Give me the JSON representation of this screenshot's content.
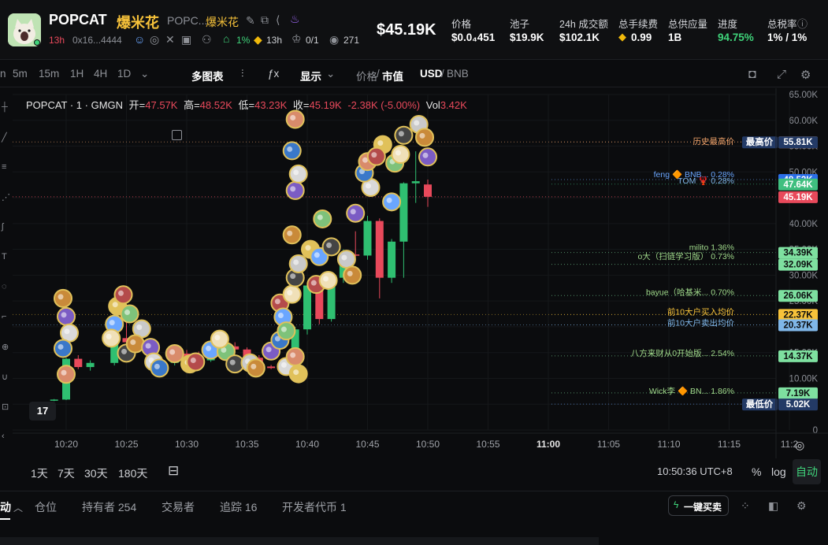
{
  "token": {
    "ticker": "POPCAT",
    "name_cn": "爆米花",
    "short_name": "POPC...",
    "short_name_cn": "爆米花",
    "age": "13h",
    "address": "0x16...4444",
    "holder_pct": "1%",
    "age2": "13h",
    "ratio": "0/1",
    "views": "271"
  },
  "price_big": "$45.19K",
  "stats": [
    {
      "label": "价格",
      "value": "$0.0₄451"
    },
    {
      "label": "池子",
      "value": "$19.9K"
    },
    {
      "label": "24h 成交额",
      "value": "$102.1K"
    },
    {
      "label": "总手续费",
      "value": "0.99"
    },
    {
      "label": "总供应量",
      "value": "1B"
    },
    {
      "label": "进度",
      "value": "94.75%"
    },
    {
      "label": "总税率",
      "value": "1% / 1%"
    }
  ],
  "toolbar": {
    "intervals": [
      "5m",
      "15m",
      "1H",
      "4H",
      "1D"
    ],
    "multi_chart": "多图表",
    "display": "显示",
    "price_label": "价格",
    "mcap_label": "市值",
    "usd_label": "USD",
    "bnb_label": "BNB"
  },
  "legend": {
    "symbol": "POPCAT · 1 · GMGN",
    "o_label": "开=",
    "o": "47.57K",
    "h_label": "高=",
    "h": "48.52K",
    "l_label": "低=",
    "l": "43.23K",
    "c_label": "收=",
    "c": "45.19K",
    "chg": "-2.38K (-5.00%)",
    "vol_label": "Vol",
    "vol": "3.42K"
  },
  "chart_data": {
    "type": "candlestick",
    "x_ticks": [
      "10:20",
      "10:25",
      "10:30",
      "10:35",
      "10:40",
      "10:45",
      "10:50",
      "10:55",
      "11:00",
      "11:05",
      "11:10",
      "11:15",
      "11:2"
    ],
    "y_ticks": [
      "65.00K",
      "60.00K",
      "55.00K",
      "50.00K",
      "45.00K",
      "40.00K",
      "35.00K",
      "30.00K",
      "25.00K",
      "20.00K",
      "15.00K",
      "10.00K",
      "5.00K",
      "0"
    ],
    "y_range": [
      0,
      65000
    ],
    "candles": [
      {
        "t": "10:19",
        "o": 5800,
        "h": 6000,
        "l": 5600,
        "c": 5900
      },
      {
        "t": "10:20",
        "o": 5900,
        "h": 14000,
        "l": 5800,
        "c": 13800
      },
      {
        "t": "10:21",
        "o": 13800,
        "h": 14500,
        "l": 11800,
        "c": 12200
      },
      {
        "t": "10:22",
        "o": 12200,
        "h": 13500,
        "l": 11500,
        "c": 13000
      },
      {
        "t": "10:24",
        "o": 13000,
        "h": 18500,
        "l": 12500,
        "c": 17800
      },
      {
        "t": "10:25",
        "o": 17800,
        "h": 21000,
        "l": 16500,
        "c": 17000
      },
      {
        "t": "10:26",
        "o": 17000,
        "h": 17500,
        "l": 15000,
        "c": 16000
      },
      {
        "t": "10:27",
        "o": 16000,
        "h": 16500,
        "l": 12800,
        "c": 13200
      },
      {
        "t": "10:28",
        "o": 13200,
        "h": 13800,
        "l": 11800,
        "c": 13000
      },
      {
        "t": "10:29",
        "o": 13000,
        "h": 15500,
        "l": 12500,
        "c": 14800
      },
      {
        "t": "10:30",
        "o": 14800,
        "h": 15500,
        "l": 13500,
        "c": 14200
      },
      {
        "t": "10:31",
        "o": 14200,
        "h": 15200,
        "l": 12800,
        "c": 13500
      },
      {
        "t": "10:32",
        "o": 13500,
        "h": 15000,
        "l": 13200,
        "c": 14800
      },
      {
        "t": "10:33",
        "o": 14800,
        "h": 16500,
        "l": 14000,
        "c": 16200
      },
      {
        "t": "10:34",
        "o": 16200,
        "h": 17000,
        "l": 15000,
        "c": 15600
      },
      {
        "t": "10:35",
        "o": 15600,
        "h": 16000,
        "l": 13800,
        "c": 14000
      },
      {
        "t": "10:36",
        "o": 14000,
        "h": 14500,
        "l": 11800,
        "c": 12300
      },
      {
        "t": "10:37",
        "o": 12300,
        "h": 12600,
        "l": 11800,
        "c": 12000
      },
      {
        "t": "10:38",
        "o": 12000,
        "h": 13000,
        "l": 11800,
        "c": 12800
      },
      {
        "t": "10:39",
        "o": 12800,
        "h": 20000,
        "l": 12500,
        "c": 19500
      },
      {
        "t": "10:40",
        "o": 19500,
        "h": 28500,
        "l": 18500,
        "c": 28000
      },
      {
        "t": "10:41",
        "o": 28000,
        "h": 29000,
        "l": 20500,
        "c": 21500
      },
      {
        "t": "10:42",
        "o": 21500,
        "h": 30000,
        "l": 21000,
        "c": 29500
      },
      {
        "t": "10:43",
        "o": 29500,
        "h": 35000,
        "l": 28500,
        "c": 34000
      },
      {
        "t": "10:44",
        "o": 34000,
        "h": 38500,
        "l": 33500,
        "c": 33800
      },
      {
        "t": "10:45",
        "o": 33800,
        "h": 41500,
        "l": 33000,
        "c": 40500
      },
      {
        "t": "10:46",
        "o": 40500,
        "h": 41000,
        "l": 25500,
        "c": 29500
      },
      {
        "t": "10:47",
        "o": 29500,
        "h": 37000,
        "l": 28500,
        "c": 36500
      },
      {
        "t": "10:48",
        "o": 36500,
        "h": 48000,
        "l": 29500,
        "c": 47800
      },
      {
        "t": "10:49",
        "o": 47800,
        "h": 54000,
        "l": 44000,
        "c": 48200
      },
      {
        "t": "10:50",
        "o": 47570,
        "h": 48520,
        "l": 43230,
        "c": 45190
      }
    ],
    "price_tags": [
      {
        "value": "55.81K",
        "color": "#f2a46b"
      },
      {
        "value": "55.81K",
        "color": "#233a66",
        "prefix": "最高价"
      },
      {
        "value": "48.52K",
        "color": "#2a6ee8"
      },
      {
        "value": "47.64K",
        "color": "#3fbf7f"
      },
      {
        "value": "45.19K",
        "color": "#e8495b"
      },
      {
        "value": "34.39K",
        "color": "#7ee0a0"
      },
      {
        "value": "32.09K",
        "color": "#7ee0a0"
      },
      {
        "value": "26.06K",
        "color": "#7ee0a0"
      },
      {
        "value": "22.37K",
        "color": "#f7c23a"
      },
      {
        "value": "20.37K",
        "color": "#7fb6e8"
      },
      {
        "value": "14.37K",
        "color": "#7ee0a0"
      },
      {
        "value": "7.19K",
        "color": "#7ee0a0"
      },
      {
        "value": "5.02K",
        "color": "#233a66",
        "prefix": "最低价"
      }
    ],
    "annotations": [
      {
        "text": "历史最高价",
        "y": 55810,
        "color": "#f2a46b"
      },
      {
        "text": "feng 🔶 BNB... 0.28%",
        "y": 49400,
        "color": "#6aa6ff"
      },
      {
        "text": "TOM 🦞 0.28%",
        "y": 48200,
        "color": "#7fb6e8"
      },
      {
        "text": "milito 1.36%",
        "y": 35300,
        "color": "#9fd88a"
      },
      {
        "text": "o大（扫链学习版） 0.73%",
        "y": 33600,
        "color": "#9fd88a"
      },
      {
        "text": "bayue（哈基米... 0.70%",
        "y": 26600,
        "color": "#9fd88a"
      },
      {
        "text": "前10大户买入均价",
        "y": 22800,
        "color": "#f7c23a"
      },
      {
        "text": "前10大户卖出均价",
        "y": 20700,
        "color": "#7fb6e8"
      },
      {
        "text": "八方来财从0开始版... 2.54%",
        "y": 14800,
        "color": "#9fd88a"
      },
      {
        "text": "Wick李 🔶 BN... 1.86%",
        "y": 7500,
        "color": "#9fd88a"
      }
    ]
  },
  "bottom": {
    "ranges": [
      "1天",
      "7天",
      "30天",
      "180天"
    ],
    "time": "10:50:36 UTC+8",
    "pct": "%",
    "log": "log",
    "auto": "自动"
  },
  "tabs": {
    "active": "动",
    "items": [
      "仓位",
      "持有者 254",
      "交易者",
      "追踪 16",
      "开发者代币 1"
    ],
    "quick_buy": "一键买卖"
  }
}
